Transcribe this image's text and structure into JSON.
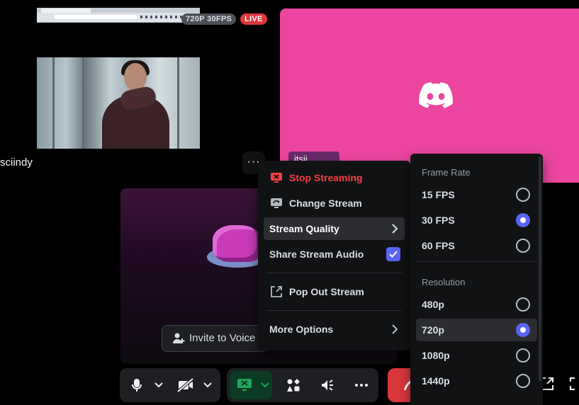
{
  "stream_tile": {
    "quality_badge": "720P 30FPS",
    "live_badge": "LIVE",
    "username": "sciindy",
    "more_button": "···"
  },
  "pink_tile": {
    "name_tag": "itsji...",
    "background_color": "#eb459f",
    "icon": "discord-logo-icon"
  },
  "activity_card": {
    "invite_button": "Invite to Voice"
  },
  "context_menu": {
    "items": [
      {
        "label": "Stop Streaming",
        "icon": "stop-stream-icon"
      },
      {
        "label": "Change Stream",
        "icon": "change-stream-icon"
      },
      {
        "label": "Stream Quality",
        "icon": "chevron-right-icon"
      },
      {
        "label": "Share Stream Audio",
        "checked": true
      },
      {
        "label": "Pop Out Stream",
        "icon": "pop-out-icon"
      },
      {
        "label": "More Options",
        "icon": "chevron-right-icon"
      }
    ]
  },
  "stream_quality_menu": {
    "frame_rate_header": "Frame Rate",
    "frame_rates": [
      {
        "label": "15 FPS",
        "selected": false
      },
      {
        "label": "30 FPS",
        "selected": true
      },
      {
        "label": "60 FPS",
        "selected": false
      }
    ],
    "resolution_header": "Resolution",
    "resolutions": [
      {
        "label": "480p",
        "selected": false
      },
      {
        "label": "720p",
        "selected": true
      },
      {
        "label": "1080p",
        "selected": false
      },
      {
        "label": "1440p",
        "selected": false
      }
    ]
  },
  "control_bar": {
    "buttons": [
      "microphone-icon",
      "chevron-down-icon",
      "camera-off-icon",
      "chevron-down-icon",
      "screen-share-icon",
      "activities-icon",
      "soundboard-icon",
      "more-icon",
      "hang-up-icon"
    ]
  },
  "colors": {
    "accent": "#5865f2",
    "danger": "#f23f43",
    "menu_bg": "#111214",
    "live": "#da373c"
  }
}
